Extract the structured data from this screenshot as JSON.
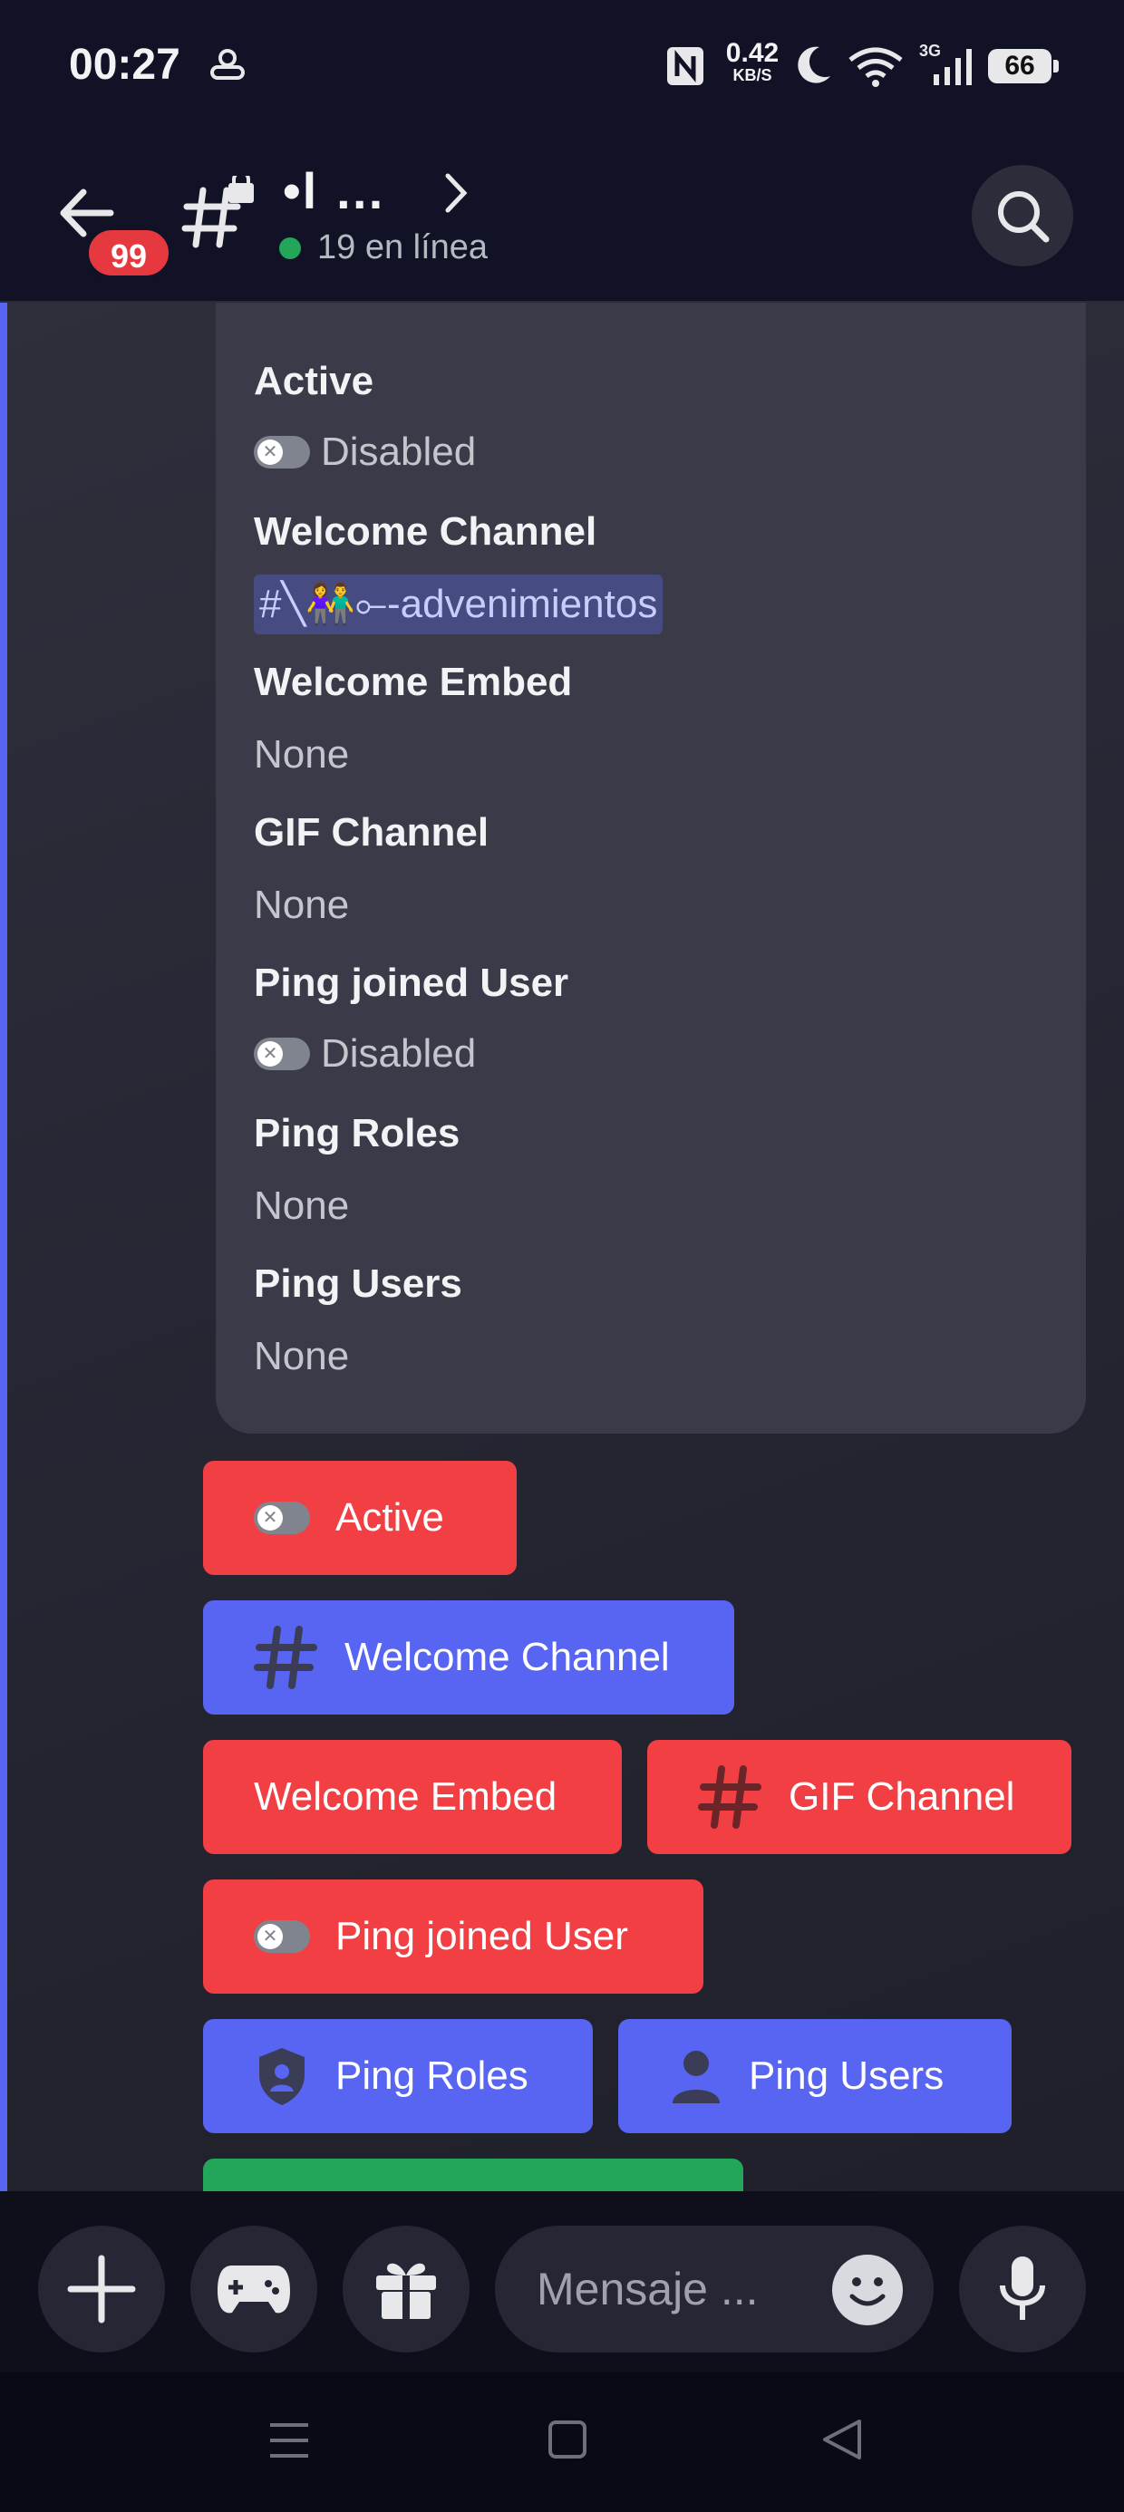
{
  "status_bar": {
    "time": "00:27",
    "net_speed_value": "0.42",
    "net_speed_unit": "KB/S",
    "network_type": "3G",
    "battery": "66",
    "icons": [
      "bluetooth-tag-icon",
      "nfc-icon",
      "moon-icon",
      "wifi-icon",
      "signal-icon",
      "battery-icon"
    ]
  },
  "header": {
    "unread_badge": "99",
    "server_name": "•l …",
    "online_status": "19 en línea",
    "colors": {
      "badge": "#e5393f",
      "online": "#23a55a"
    }
  },
  "embed": {
    "fields": [
      {
        "name": "Active",
        "value": "Disabled",
        "kind": "toggle"
      },
      {
        "name": "Welcome Channel",
        "value": "#╲👫⟜-advenimientos",
        "kind": "mention"
      },
      {
        "name": "Welcome Embed",
        "value": "None",
        "kind": "text"
      },
      {
        "name": "GIF Channel",
        "value": "None",
        "kind": "text"
      },
      {
        "name": "Ping joined User",
        "value": "Disabled",
        "kind": "toggle"
      },
      {
        "name": "Ping Roles",
        "value": "None",
        "kind": "text"
      },
      {
        "name": "Ping Users",
        "value": "None",
        "kind": "text"
      }
    ]
  },
  "buttons": [
    {
      "label": "Active",
      "style": "red",
      "icon": "toggle-off-icon"
    },
    {
      "label": "Welcome Channel",
      "style": "blue",
      "icon": "hash-icon"
    },
    {
      "label": "Welcome Embed",
      "style": "red",
      "icon": ""
    },
    {
      "label": "GIF Channel",
      "style": "red",
      "icon": "hash-icon"
    },
    {
      "label": "Ping joined User",
      "style": "red",
      "icon": "toggle-off-icon"
    },
    {
      "label": "Ping Roles",
      "style": "blue",
      "icon": "shield-user-icon"
    },
    {
      "label": "Ping Users",
      "style": "blue",
      "icon": "user-icon"
    }
  ],
  "button_colors": {
    "red": "#f23f43",
    "blue": "#5865f2",
    "green": "#23a55a"
  },
  "composer": {
    "placeholder": "Mensaje ...",
    "icons": [
      "plus-icon",
      "gamepad-icon",
      "gift-icon",
      "emoji-icon",
      "microphone-icon"
    ]
  },
  "nav": {
    "icons": [
      "menu-icon",
      "home-icon",
      "back-icon"
    ]
  }
}
